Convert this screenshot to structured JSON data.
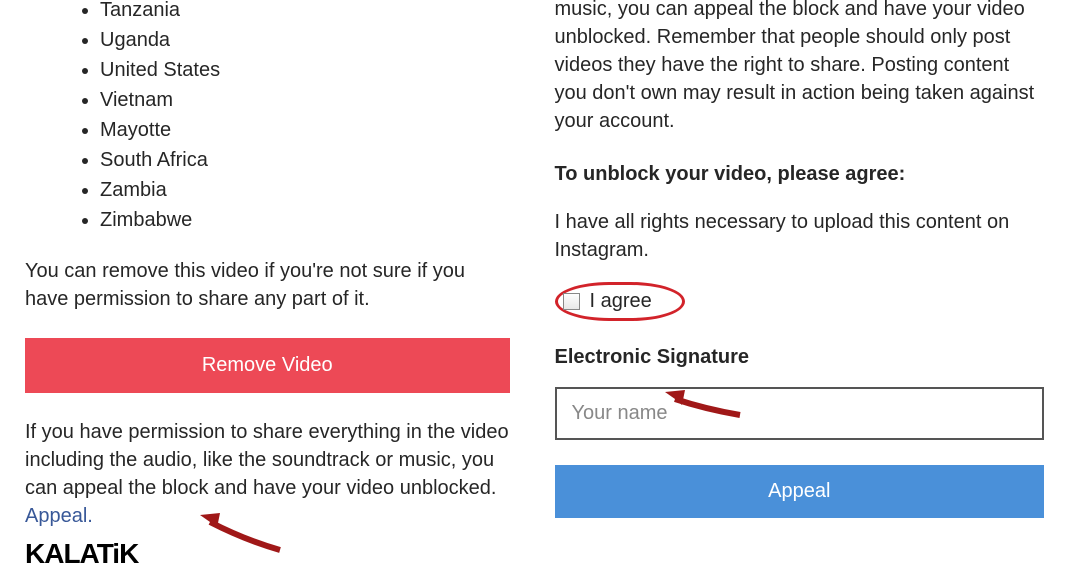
{
  "left": {
    "countries": [
      "Tanzania",
      "Uganda",
      "United States",
      "Vietnam",
      "Mayotte",
      "South Africa",
      "Zambia",
      "Zimbabwe"
    ],
    "remove_text": "You can remove this video if you're not sure if you have permission to share any part of it.",
    "remove_button": "Remove Video",
    "permission_text_prefix": "If you have permission to share everything in the video including the audio, like the soundtrack or music, you can appeal the block and have your video unblocked. ",
    "appeal_link": "Appeal.",
    "watermark": "KALATiK"
  },
  "right": {
    "top_text": "music, you can appeal the block and have your video unblocked. Remember that people should only post videos they have the right to share. Posting content you don't own may result in action being taken against your account.",
    "agree_heading": "To unblock your video, please agree:",
    "rights_text": "I have all rights necessary to upload this content on Instagram.",
    "agree_label": "I agree",
    "sig_heading": "Electronic Signature",
    "sig_placeholder": "Your name",
    "appeal_button": "Appeal"
  }
}
